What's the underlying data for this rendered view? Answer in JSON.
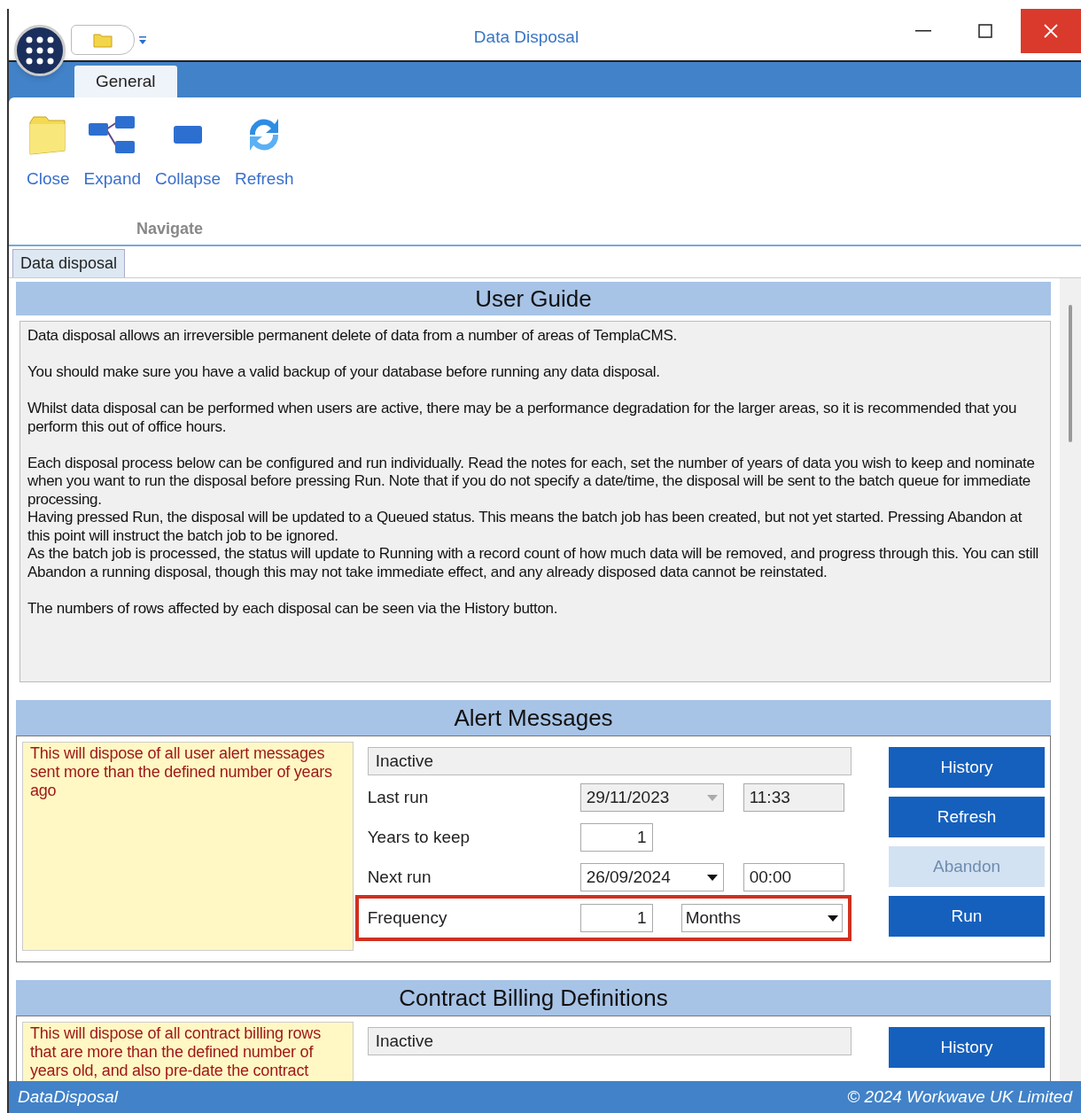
{
  "window": {
    "title": "Data Disposal"
  },
  "ribbon": {
    "tabs": [
      {
        "label": "General",
        "selected": true
      }
    ],
    "buttons": [
      {
        "label": "Close",
        "kind": "folder"
      },
      {
        "label": "Expand",
        "kind": "expand"
      },
      {
        "label": "Collapse",
        "kind": "collapse"
      },
      {
        "label": "Refresh",
        "kind": "refresh"
      }
    ],
    "group": "Navigate"
  },
  "document_tabs": [
    {
      "label": "Data disposal",
      "selected": true
    }
  ],
  "user_guide": {
    "title": "User Guide",
    "blocks": [
      [
        "Data disposal allows an irreversible permanent delete of data from a number of areas of TemplaCMS."
      ],
      [
        "You should make sure you have a valid backup of your database before running any data disposal."
      ],
      [
        "Whilst data disposal can be performed when users are active, there may be a performance degradation for the larger areas, so it is recommended that you perform this out of office hours."
      ],
      [
        "Each disposal process below can be configured and run individually. Read the notes for each, set the number of years of data you wish to keep and nominate when you want to run the disposal before pressing Run. Note that if you do not specify a date/time, the disposal will be sent to the batch queue for immediate processing.",
        "Having pressed Run, the disposal will be updated to a Queued status. This means the batch job has been created, but not yet started. Pressing Abandon at this point will instruct the batch job to be ignored.",
        "As the batch job is processed, the status will update to Running with a record count of how much data will be removed, and progress through this. You can still Abandon a running disposal, though this may not take immediate effect, and any already disposed data cannot be reinstated."
      ],
      [
        "The numbers of rows affected by each disposal can be seen via the History button."
      ]
    ]
  },
  "sections": [
    {
      "title": "Alert Messages",
      "description": "This will dispose of all user alert messages sent more than the defined number of years ago",
      "status": "Inactive",
      "rows": [
        {
          "kind": "datetime",
          "label": "Last run",
          "date": "29/11/2023",
          "time": "11:33",
          "disabled": true
        },
        {
          "kind": "number",
          "label": "Years to keep",
          "value": "1"
        },
        {
          "kind": "datetime",
          "label": "Next run",
          "date": "26/09/2024",
          "time": "00:00",
          "disabled": false
        },
        {
          "kind": "frequency",
          "label": "Frequency",
          "value": "1",
          "unit": "Months",
          "highlighted": true
        }
      ],
      "buttons": [
        {
          "label": "History",
          "disabled": false
        },
        {
          "label": "Refresh",
          "disabled": false
        },
        {
          "label": "Abandon",
          "disabled": true
        },
        {
          "label": "Run",
          "disabled": false
        }
      ]
    },
    {
      "title": "Contract Billing Definitions",
      "description": "This will dispose of all contract billing rows that are more than the defined number of years old, and also pre-date the contract",
      "status": "Inactive",
      "buttons": [
        {
          "label": "History",
          "disabled": false
        }
      ]
    }
  ],
  "status_bar": {
    "left": "DataDisposal",
    "right": "© 2024 Workwave UK Limited"
  }
}
